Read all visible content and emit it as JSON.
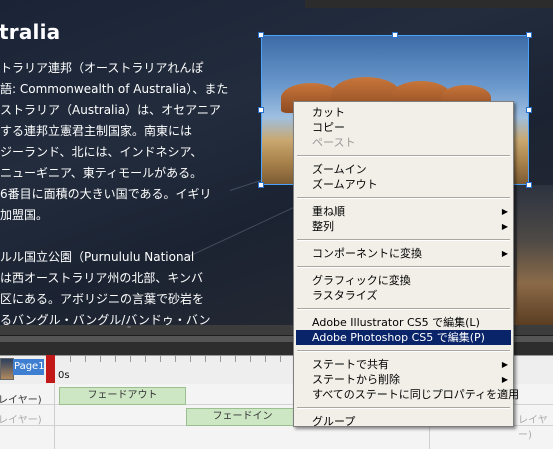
{
  "top_bar": {
    "label": ""
  },
  "artboard": {
    "heading": "tralia",
    "paragraph1": [
      "トラリア連邦（オーストラリアれんぽ",
      "語: Commonwealth of Australia）、また",
      "ストラリア（Australia）は、オセアニア",
      "する連邦立憲君主制国家。南東には",
      "ジーランド、北には、インドネシア、",
      "ニューギニア、東ティモールがある。",
      "6番目に面積の大きい国である。イギリ",
      "加盟国。"
    ],
    "paragraph2": [
      "ルル国立公園（Purnululu National",
      "は西オーストラリア州の北部、キンバ",
      "区にある。アボリジニの言葉で砂岩を",
      "るバングル・バングル/バンドゥ・バン"
    ]
  },
  "timeline": {
    "grip": "''",
    "page_label": "Page1",
    "time_label": "0s",
    "layers_left": [
      "レイヤー)",
      "レイヤー)"
    ],
    "layers_right": [
      "レイヤー)"
    ],
    "tweens": [
      "フェードアウト",
      "フェードイン"
    ]
  },
  "context_menu": {
    "groups": [
      [
        {
          "label": "カット",
          "enabled": true,
          "submenu": false
        },
        {
          "label": "コピー",
          "enabled": true,
          "submenu": false
        },
        {
          "label": "ペースト",
          "enabled": false,
          "submenu": false
        }
      ],
      [
        {
          "label": "ズームイン",
          "enabled": true,
          "submenu": false
        },
        {
          "label": "ズームアウト",
          "enabled": true,
          "submenu": false
        }
      ],
      [
        {
          "label": "重ね順",
          "enabled": true,
          "submenu": true
        },
        {
          "label": "整列",
          "enabled": true,
          "submenu": true
        }
      ],
      [
        {
          "label": "コンポーネントに変換",
          "enabled": true,
          "submenu": true
        }
      ],
      [
        {
          "label": "グラフィックに変換",
          "enabled": true,
          "submenu": false
        },
        {
          "label": "ラスタライズ",
          "enabled": true,
          "submenu": false
        }
      ],
      [
        {
          "label": "Adobe Illustrator CS5 で編集(L)",
          "enabled": true,
          "submenu": false
        },
        {
          "label": "Adobe Photoshop CS5 で編集(P)",
          "enabled": true,
          "submenu": false,
          "highlighted": true
        }
      ],
      [
        {
          "label": "ステートで共有",
          "enabled": true,
          "submenu": true
        },
        {
          "label": "ステートから削除",
          "enabled": true,
          "submenu": true
        },
        {
          "label": "すべてのステートに同じプロパティを適用",
          "enabled": true,
          "submenu": false
        }
      ],
      [
        {
          "label": "グループ",
          "enabled": true,
          "submenu": false
        }
      ]
    ],
    "highlight_color": "#0a246a",
    "submenu_glyph": "▶"
  },
  "colors": {
    "selection": "#4aa3ff",
    "playhead": "#c21818",
    "tween": "#cde6c4",
    "page_tab": "#3f7fd1"
  }
}
